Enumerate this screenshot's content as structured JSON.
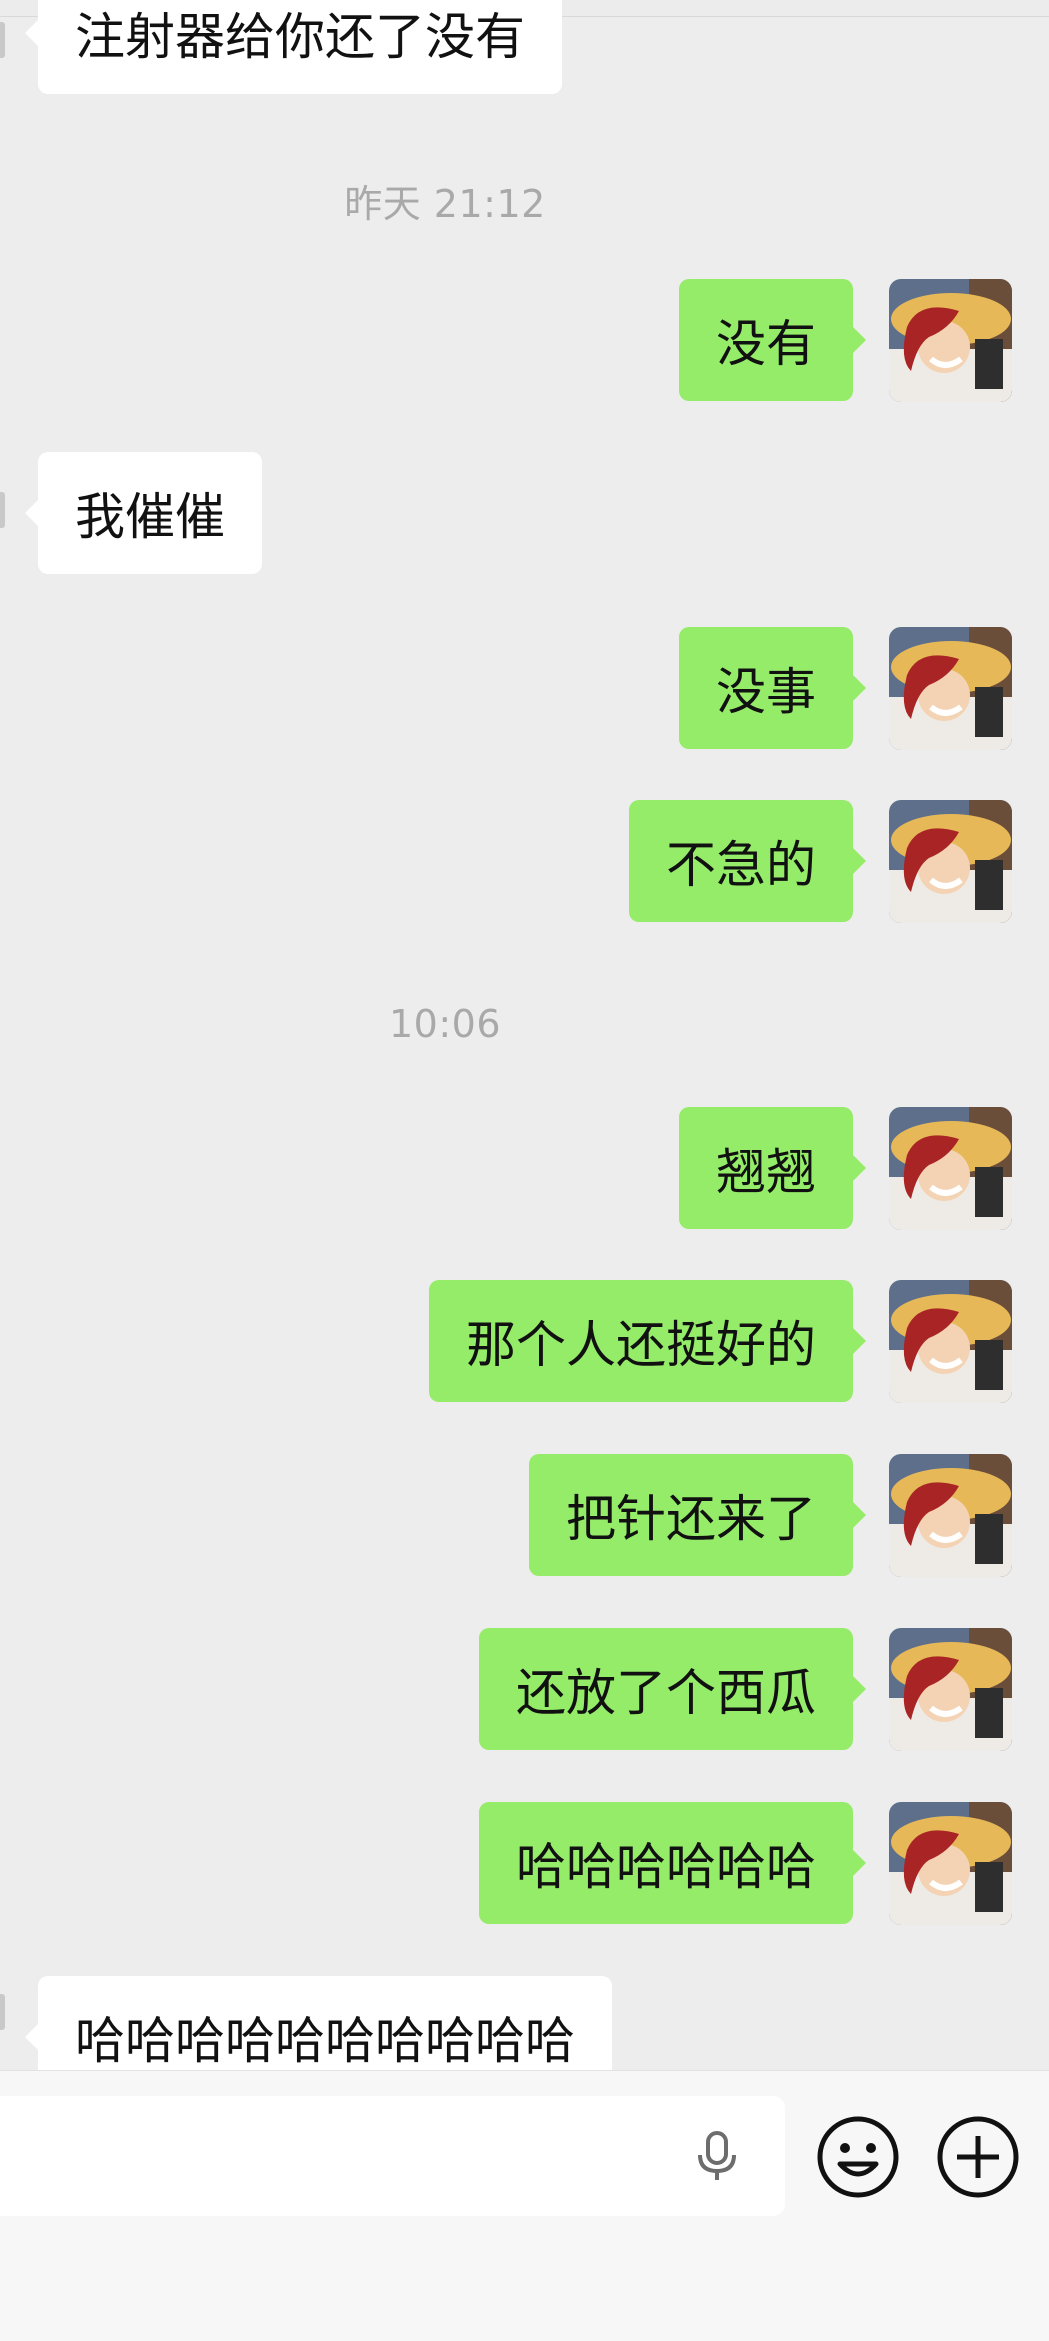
{
  "messages": [
    {
      "side": "in",
      "text": "注射器给你还了没有"
    },
    {
      "side": "ts",
      "text": "昨天 21:12"
    },
    {
      "side": "out",
      "text": "没有"
    },
    {
      "side": "in",
      "text": "我催催"
    },
    {
      "side": "out",
      "text": "没事"
    },
    {
      "side": "out",
      "text": "不急的"
    },
    {
      "side": "ts",
      "text": "10:06"
    },
    {
      "side": "out",
      "text": "翘翘"
    },
    {
      "side": "out",
      "text": "那个人还挺好的"
    },
    {
      "side": "out",
      "text": "把针还来了"
    },
    {
      "side": "out",
      "text": "还放了个西瓜"
    },
    {
      "side": "out",
      "text": "哈哈哈哈哈哈"
    },
    {
      "side": "in",
      "text": "哈哈哈哈哈哈哈哈哈哈"
    }
  ],
  "input": {
    "value": ""
  },
  "icons": {
    "mic": "microphone-icon",
    "emoji": "emoji-icon",
    "plus": "plus-icon"
  },
  "colors": {
    "outgoing_bubble": "#95ec69",
    "incoming_bubble": "#ffffff",
    "background": "#ededed"
  }
}
